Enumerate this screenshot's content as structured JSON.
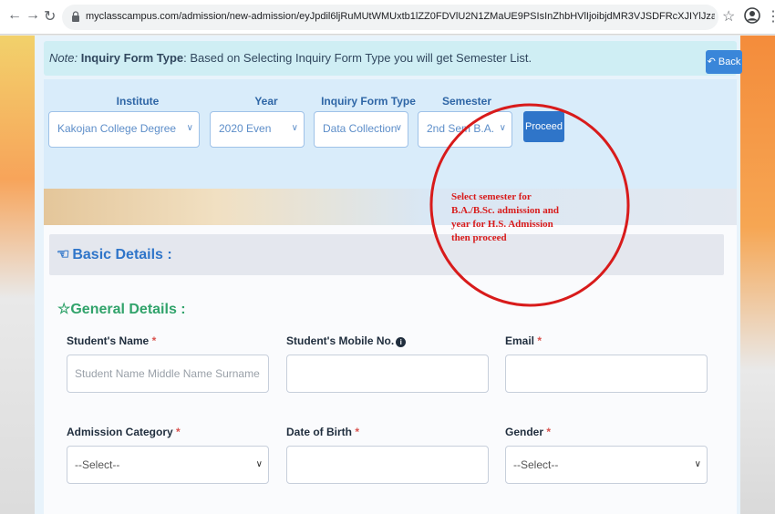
{
  "browser": {
    "url": "myclasscampus.com/admission/new-admission/eyJpdil6ljRuMUtWMUxtb1lZZ0FDVlU2N1ZMaUE9PSIsInZhbHVlIjoibjdMR3VJSDFRcXJIYlJzamhyWkFJZz09IiwibWFjIjoiZmZiYWUyMjl..."
  },
  "note": {
    "prefix": "Note:",
    "bold": "Inquiry Form Type",
    "text": ": Based on Selecting Inquiry Form Type you will get Semester List."
  },
  "back_button": {
    "label": "Back"
  },
  "inquiry": {
    "institute": {
      "label": "Institute",
      "value": "Kakojan College Degree"
    },
    "year": {
      "label": "Year",
      "value": "2020 Even"
    },
    "form_type": {
      "label": "Inquiry Form Type",
      "value": "Data Collection"
    },
    "semester": {
      "label": "Semester",
      "value": "2nd Sem B.A."
    },
    "proceed_label": "Proceed"
  },
  "annotation": {
    "lines": [
      "Select semester for",
      "B.A./B.Sc. admission and",
      "year for H.S. Admission",
      "then proceed"
    ],
    "color": "#d81b1b"
  },
  "basic_details": {
    "title": "Basic Details :"
  },
  "general_details": {
    "title": "General Details :",
    "fields": {
      "student_name": {
        "label": "Student's Name",
        "placeholder": "Student Name   Middle Name   Surname"
      },
      "mobile": {
        "label": "Student's Mobile No."
      },
      "email": {
        "label": "Email"
      },
      "admission_category": {
        "label": "Admission Category",
        "value": "--Select--"
      },
      "dob": {
        "label": "Date of Birth"
      },
      "gender": {
        "label": "Gender",
        "value": "--Select--"
      }
    }
  },
  "colors": {
    "primary_blue": "#2f75c9",
    "note_bg": "#cfeef4",
    "panel_bg": "#d9ecfa",
    "general_green": "#31a36b",
    "required_red": "#d9534f"
  },
  "icons": {
    "lock": "lock-icon",
    "star": "bookmark-star-icon",
    "back": "back-arrow-icon",
    "hand": "thumbs-up-icon",
    "section_star": "star-outline-icon"
  }
}
